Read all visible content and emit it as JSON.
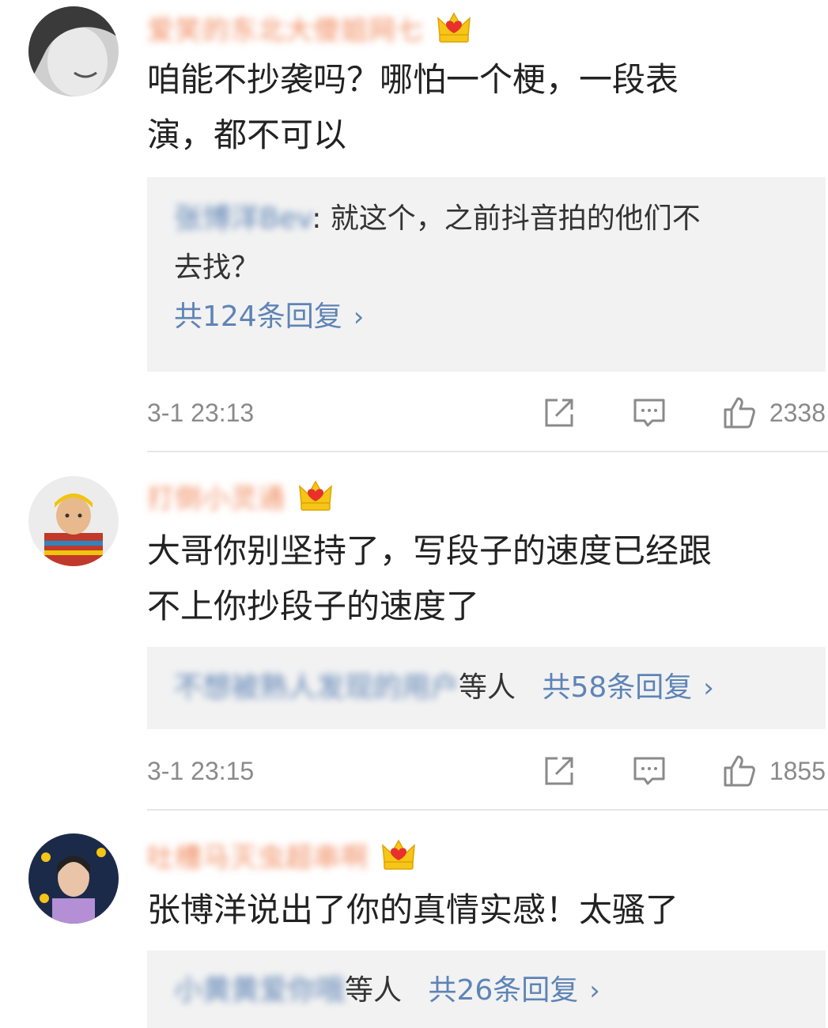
{
  "comments": [
    {
      "username": "爱笑的东北大傻姐网七",
      "level": "4",
      "text_line1": "咱能不抄袭吗？哪怕一个梗，一段表",
      "text_line2": "演，都不可以",
      "reply": {
        "author": "张博洋Bev",
        "text_line1": "就这个，之前抖音拍的他们不",
        "text_line2": "去找？"
      },
      "reply_summary": "共124条回复",
      "time": "3-1 23:13",
      "likes": "2338"
    },
    {
      "username": "打倒小灵通",
      "level": "5",
      "text_line1": "大哥你别坚持了，写段子的速度已经跟",
      "text_line2": "不上你抄段子的速度了",
      "reply_names": "不想被熟人发现的用户",
      "reply_suffix": "等人",
      "reply_summary": "共58条回复",
      "time": "3-1 23:15",
      "likes": "1855"
    },
    {
      "username": "吐槽马灭虫超串啊",
      "level": "4",
      "text_line1": "张博洋说出了你的真情实感！太骚了",
      "reply_names": "小黄黄爱你哦",
      "reply_suffix": "等人",
      "reply_summary": "共26条回复"
    }
  ],
  "reply_chevron": "›",
  "icons": [
    "avatar",
    "crown-badge-icon",
    "share-icon",
    "comment-icon",
    "thumbs-up-icon",
    "chevron-right-icon"
  ]
}
